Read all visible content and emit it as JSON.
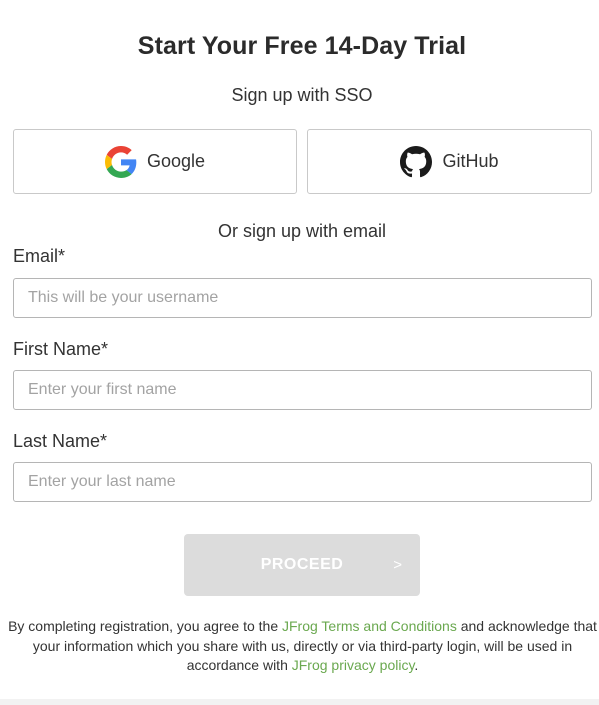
{
  "header": {
    "title": "Start Your Free 14-Day Trial",
    "sso_heading": "Sign up with SSO"
  },
  "sso": {
    "google_label": "Google",
    "github_label": "GitHub"
  },
  "form": {
    "email_heading": "Or sign up with email",
    "email": {
      "label": "Email*",
      "placeholder": "This will be your username",
      "value": ""
    },
    "first_name": {
      "label": "First Name*",
      "placeholder": "Enter your first name",
      "value": ""
    },
    "last_name": {
      "label": "Last Name*",
      "placeholder": "Enter your last name",
      "value": ""
    }
  },
  "proceed": {
    "label": "PROCEED",
    "arrow": ">"
  },
  "legal": {
    "prefix": "By completing registration, you agree to the ",
    "terms_link": "JFrog Terms and Conditions",
    "middle": " and acknowledge that your information which you share with us, directly or via third-party login, will be used in accordance with ",
    "privacy_link": "JFrog privacy policy",
    "suffix": "."
  },
  "colors": {
    "link": "#6aa84f",
    "button_disabled": "#dcdcdc",
    "border": "#b5b5b5"
  },
  "icons": {
    "google": "google-logo-icon",
    "github": "github-logo-icon"
  }
}
